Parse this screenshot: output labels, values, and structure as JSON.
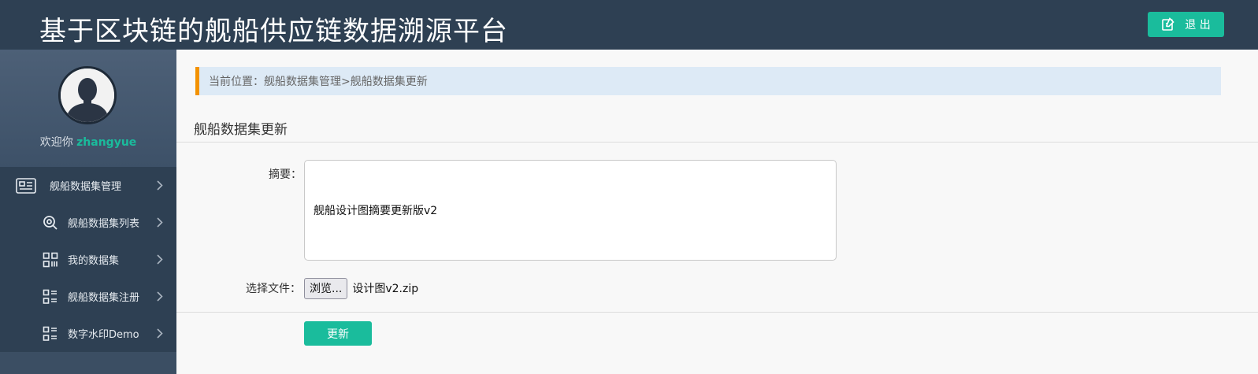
{
  "header": {
    "title": "基于区块链的舰船供应链数据溯源平台",
    "logout_label": "退 出"
  },
  "sidebar": {
    "welcome_prefix": "欢迎你",
    "username": "zhangyue",
    "menu": [
      {
        "label": "舰船数据集管理",
        "icon": "id-card-icon"
      },
      {
        "label": "舰船数据集列表",
        "icon": "search-icon"
      },
      {
        "label": "我的数据集",
        "icon": "qr-grid-icon"
      },
      {
        "label": "舰船数据集注册",
        "icon": "list-icon"
      },
      {
        "label": "数字水印Demo",
        "icon": "list-icon"
      }
    ]
  },
  "breadcrumb": "当前位置：舰船数据集管理>舰船数据集更新",
  "main": {
    "section_title": "舰船数据集更新",
    "summary_label": "摘要：",
    "summary_value": "舰船设计图摘要更新版v2",
    "file_label": "选择文件：",
    "browse_label": "浏览...",
    "file_name": "设计图v2.zip",
    "submit_label": "更新"
  },
  "colors": {
    "header_bg": "#2e4053",
    "accent": "#1abc9c",
    "breadcrumb_bar": "#f39200",
    "breadcrumb_bg": "#ddeaf6"
  }
}
